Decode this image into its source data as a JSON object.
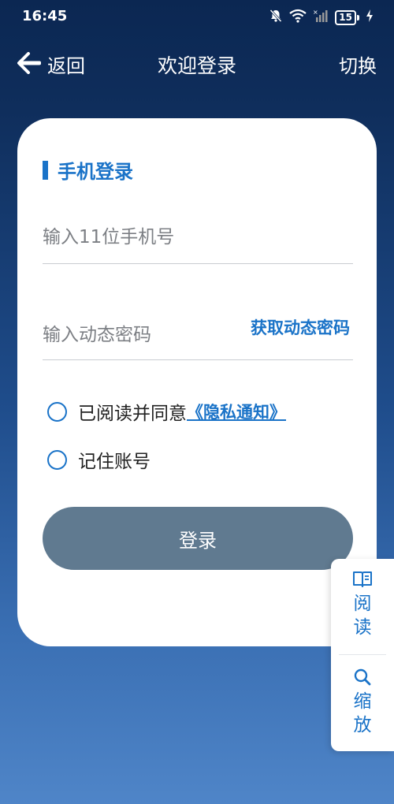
{
  "status_bar": {
    "time": "16:45",
    "battery": "15",
    "icons": [
      "mute-bell-icon",
      "wifi-icon",
      "signal-icon",
      "battery-icon",
      "charging-icon"
    ]
  },
  "header": {
    "back_label": "返回",
    "title": "欢迎登录",
    "switch_label": "切换"
  },
  "login_card": {
    "section_title": "手机登录",
    "phone_placeholder": "输入11位手机号",
    "code_placeholder": "输入动态密码",
    "get_code_label": "获取动态密码",
    "agree_label": "已阅读并同意",
    "privacy_link": "《隐私通知》",
    "remember_label": "记住账号",
    "login_button": "登录"
  },
  "float_panel": {
    "read_chars": [
      "阅",
      "读"
    ],
    "zoom_chars": [
      "缩",
      "放"
    ]
  },
  "colors": {
    "accent": "#1a73c8",
    "login_button": "#607a90",
    "background_top": "#0b2752",
    "background_bottom": "#4f85c8"
  }
}
